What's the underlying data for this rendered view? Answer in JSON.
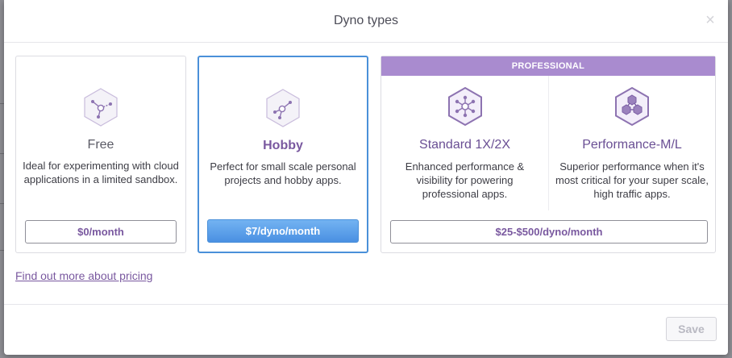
{
  "modal": {
    "title": "Dyno types",
    "close_glyph": "×",
    "pricing_link": "Find out more about pricing",
    "save_label": "Save"
  },
  "tiers": {
    "free": {
      "name": "Free",
      "icon": "single-node-icon",
      "description": "Ideal for experimenting with cloud applications in a limited sandbox.",
      "price": "$0/month"
    },
    "hobby": {
      "name": "Hobby",
      "icon": "node-network-icon",
      "description": "Perfect for small scale personal projects and hobby apps.",
      "price": "$7/dyno/month",
      "selected": true
    },
    "professional": {
      "band_label": "PROFESSIONAL",
      "price": "$25-$500/dyno/month",
      "standard": {
        "name": "Standard 1X/2X",
        "icon": "hub-network-icon",
        "description": "Enhanced performance & visibility for powering professional apps."
      },
      "performance": {
        "name": "Performance-M/L",
        "icon": "cluster-icon",
        "description": "Superior performance when it's most critical for your super scale, high traffic apps."
      }
    }
  },
  "colors": {
    "accent_purple": "#79589f",
    "professional_band": "#a98bcf",
    "selected_border": "#4a90d9",
    "selected_button": "#4a90e2"
  }
}
